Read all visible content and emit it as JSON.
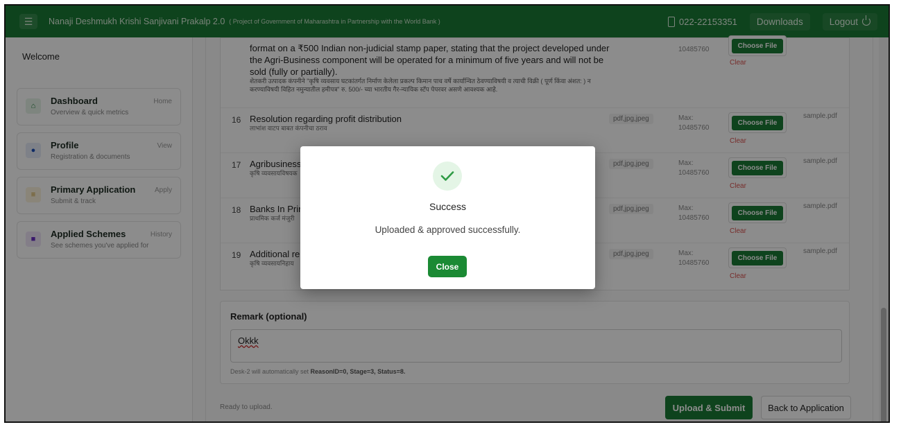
{
  "topbar": {
    "brand": "Nanaji Deshmukh Krishi Sanjivani Prakalp 2.0",
    "brand_sub": "( Project of Government of Maharashtra in Partnership with the World Bank )",
    "phone": "022-22153351",
    "downloads": "Downloads",
    "logout": "Logout"
  },
  "sidebar": {
    "welcome": "Welcome",
    "items": [
      {
        "title": "Dashboard",
        "sub": "Overview & quick metrics",
        "tag": "Home",
        "icon": "home-icon",
        "color": "#1b7a35"
      },
      {
        "title": "Profile",
        "sub": "Registration & documents",
        "tag": "View",
        "icon": "user-icon",
        "color": "#1c4fb8"
      },
      {
        "title": "Primary Application",
        "sub": "Submit & track",
        "tag": "Apply",
        "icon": "list-icon",
        "color": "#c4901a"
      },
      {
        "title": "Applied Schemes",
        "sub": "See schemes you've applied for",
        "tag": "History",
        "icon": "square-icon",
        "color": "#6a2fc4"
      }
    ]
  },
  "documents": {
    "top_text": "format on a ₹500 Indian non-judicial stamp paper, stating that the project developed under the Agri-Business component will be operated for a minimum of five years and will not be sold (fully or partially).",
    "top_text_mr": "शेतकरी उत्पादक कंपनीने \"कृषि व्यवसाय घटकांतर्गत निर्माण केलेला प्रकल्प किमान पाच वर्षे कार्यान्वित ठेवण्याविषयी व त्याची विक्री ( पूर्ण किंवा अंशत: ) न करण्याविषयी विहित नमुन्यातील हमीपत्र\" रु. 500/- च्या भारतीय गैर-न्यायिक स्टॅप पेपरवर असणे आवश्यक आहे.",
    "top_max": "10485760",
    "top_choose": "Choose File",
    "top_clear": "Clear",
    "rows": [
      {
        "num": "16",
        "title": "Resolution regarding profit distribution",
        "mr": "लाभांश वाटप बाबत कंपनीचा ठराव",
        "types": "pdf,jpg,jpeg",
        "max_label": "Max:",
        "max": "10485760",
        "choose": "Choose File",
        "clear": "Clear",
        "file": "sample.pdf"
      },
      {
        "num": "17",
        "title": "Agribusiness",
        "mr": "कृषि व्यवसायविषयक",
        "types": "pdf,jpg,jpeg",
        "max_label": "Max:",
        "max": "10485760",
        "choose": "Choose File",
        "clear": "Clear",
        "file": "sample.pdf"
      },
      {
        "num": "18",
        "title": "Banks In Prir",
        "mr": "प्राथमिक कर्ज मंजुरी",
        "types": "pdf,jpg,jpeg",
        "max_label": "Max:",
        "max": "10485760",
        "choose": "Choose File",
        "clear": "Clear",
        "file": "sample.pdf"
      },
      {
        "num": "19",
        "title": "Additional re",
        "mr": "कृषि व्यवसायनिहाय",
        "types": "pdf,jpg,jpeg",
        "max_label": "Max:",
        "max": "10485760",
        "choose": "Choose File",
        "clear": "Clear",
        "file": "sample.pdf"
      }
    ]
  },
  "remark": {
    "label": "Remark (optional)",
    "value": "Okkk",
    "note_prefix": "Desk-2 will automatically set ",
    "note_values": "ReasonID=0, Stage=3, Status=8."
  },
  "footer": {
    "status": "Ready to upload.",
    "upload": "Upload & Submit",
    "back": "Back to Application"
  },
  "modal": {
    "title": "Success",
    "message": "Uploaded & approved successfully.",
    "close": "Close"
  },
  "colors": {
    "brand_green": "#1b7a35",
    "success_check": "#2e9b45",
    "clear_red": "#d9534f"
  }
}
